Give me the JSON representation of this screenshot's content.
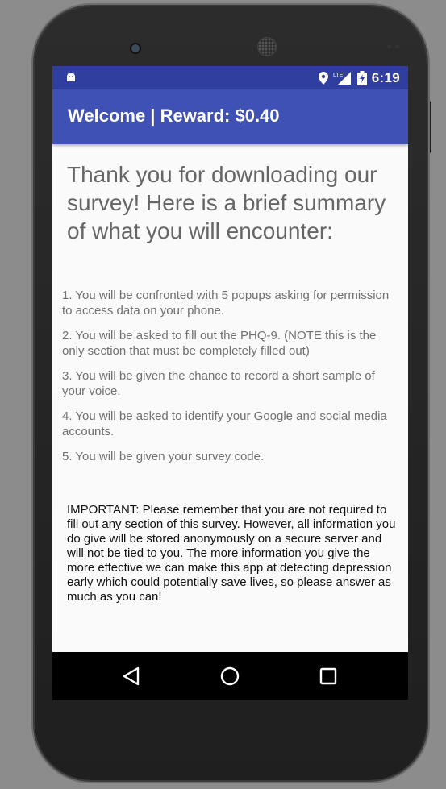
{
  "status_bar": {
    "time": "6:19",
    "network": "LTE"
  },
  "app_bar": {
    "title": "Welcome | Reward: $0.40"
  },
  "content": {
    "heading": "Thank you for downloading our survey! Here is a brief summary of what you will encounter:",
    "items": [
      "1. You will be confronted with 5 popups asking for permission to access data on your phone.",
      "2. You will be asked to fill out the PHQ-9. (NOTE this is the only section that must be completely filled out)",
      "3. You will be given the chance to record a short sample of your voice.",
      "4. You will be asked to identify your Google and social media accounts.",
      "5. You will be given your survey code."
    ],
    "important": "IMPORTANT: Please remember that you are not required to fill out any section of this survey. However, all information you do give will be stored anonymously on a secure server and will not be tied to you. The more information you give the more effective we can make this app at detecting depression early which could potentially save lives, so please answer as much as you can!"
  },
  "colors": {
    "app_bar": "#3f51b5",
    "status_bar": "#303f9f",
    "nav_bar": "#000000"
  },
  "icons": {
    "status_left": "android-icon",
    "status_right": [
      "location-icon",
      "signal-icon",
      "battery-icon"
    ],
    "nav": [
      "back-icon",
      "home-icon",
      "recent-apps-icon"
    ]
  }
}
